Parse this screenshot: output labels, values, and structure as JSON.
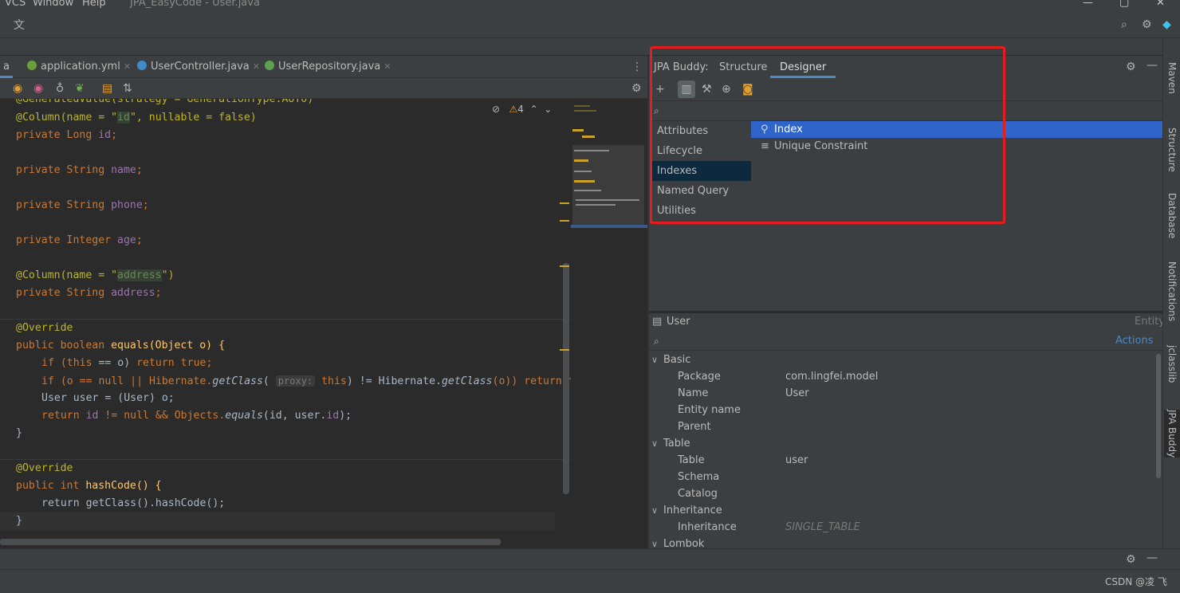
{
  "menu": {
    "vcs": "VCS",
    "window": "Window",
    "help": "Help",
    "title": "JPA_EasyCode - User.java"
  },
  "tabs": [
    {
      "label": "a"
    },
    {
      "label": "application.yml"
    },
    {
      "label": "UserController.java"
    },
    {
      "label": "UserRepository.java"
    }
  ],
  "editor": {
    "warnings": "4",
    "lines": {
      "l0": "@GeneratedValue(strategy = GenerationType.AUTO)",
      "l1a": "@Column(name = \"",
      "l1b": "id",
      "l1c": "\", nullable = false)",
      "l2a": "private Long ",
      "l2b": "id",
      "l4a": "private String ",
      "l4b": "name",
      "l6a": "private String ",
      "l6b": "phone",
      "l8a": "private Integer ",
      "l8b": "age",
      "l10a": "@Column(name = \"",
      "l10b": "address",
      "l10c": "\")",
      "l11a": "private String ",
      "l11b": "address",
      "l13": "@Override",
      "l14a": "public boolean ",
      "l14b": "equals(Object o) {",
      "l15a": "if (",
      "l15b": "this",
      "l15c": " == o) ",
      "l15d": "return true",
      "l16a": "if (o == null || Hibernate.",
      "l16b": "getClass",
      "l16c": "proxy:",
      "l16d": "this",
      "l16e": ") != Hibernate.",
      "l16f": "getClass",
      "l16g": "(o)) return fa",
      "l17": "User user = (User) o;",
      "l18a": "return ",
      "l18b": "id",
      "l18c": " != null && Objects.",
      "l18d": "equals",
      "l18e": "(id, user.",
      "l18f": "id",
      "l18g": ");",
      "l19": "}",
      "l21": "@Override",
      "l22a": "public int ",
      "l22b": "hashCode() {",
      "l23": "return getClass().hashCode();",
      "l24": "}"
    }
  },
  "jpa": {
    "label": "JPA Buddy:",
    "tab_structure": "Structure",
    "tab_designer": "Designer",
    "categories": [
      "Attributes",
      "Lifecycle Callbacks",
      "Indexes",
      "Named Query",
      "Utilities"
    ],
    "items": [
      "Index",
      "Unique Constraint"
    ]
  },
  "inspector": {
    "entity": "User",
    "entity_type": "Entity",
    "actions": "Actions",
    "basic": "Basic",
    "package_k": "Package",
    "package_v": "com.lingfei.model",
    "name_k": "Name",
    "name_v": "User",
    "entityname_k": "Entity name",
    "parent_k": "Parent",
    "table": "Table",
    "table_k": "Table",
    "table_v": "user",
    "schema_k": "Schema",
    "catalog_k": "Catalog",
    "inheritance": "Inheritance",
    "inheritance_k": "Inheritance",
    "inheritance_v": "SINGLE_TABLE",
    "lombok": "Lombok"
  },
  "rightbar": [
    "Maven",
    "Structure",
    "Database",
    "Notifications",
    "jclasslib",
    "JPA Buddy"
  ],
  "status": {
    "watermark": "CSDN @凌 飞"
  }
}
